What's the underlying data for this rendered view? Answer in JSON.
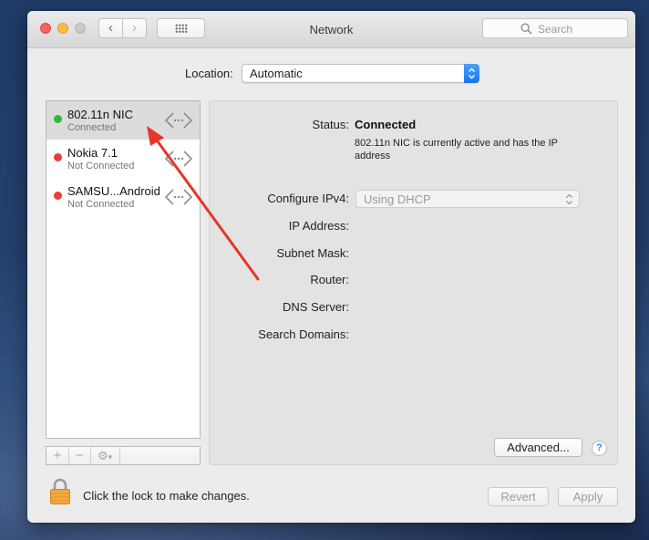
{
  "window": {
    "title": "Network",
    "search_placeholder": "Search"
  },
  "location": {
    "label": "Location:",
    "value": "Automatic"
  },
  "services": [
    {
      "name": "802.11n NIC",
      "status": "Connected",
      "status_color": "#2dbb3a",
      "selected": true
    },
    {
      "name": "Nokia 7.1",
      "status": "Not Connected",
      "status_color": "#ee3c38",
      "selected": false
    },
    {
      "name": "SAMSU...Android",
      "status": "Not Connected",
      "status_color": "#ee3c38",
      "selected": false
    }
  ],
  "list_footer": {
    "add": "+",
    "remove": "−",
    "gear": "⚙"
  },
  "details": {
    "status_label": "Status:",
    "status_value": "Connected",
    "status_description": "802.11n NIC is currently active and has the IP address",
    "configure_ipv4_label": "Configure IPv4:",
    "configure_ipv4_value": "Using DHCP",
    "ip_address_label": "IP Address:",
    "subnet_mask_label": "Subnet Mask:",
    "router_label": "Router:",
    "dns_server_label": "DNS Server:",
    "search_domains_label": "Search Domains:",
    "advanced_button": "Advanced...",
    "help_button": "?"
  },
  "footer": {
    "lock_text": "Click the lock to make changes.",
    "revert_button": "Revert",
    "apply_button": "Apply"
  },
  "colors": {
    "annotation_arrow": "#e8352a",
    "accent_blue": "#1a74ea"
  }
}
